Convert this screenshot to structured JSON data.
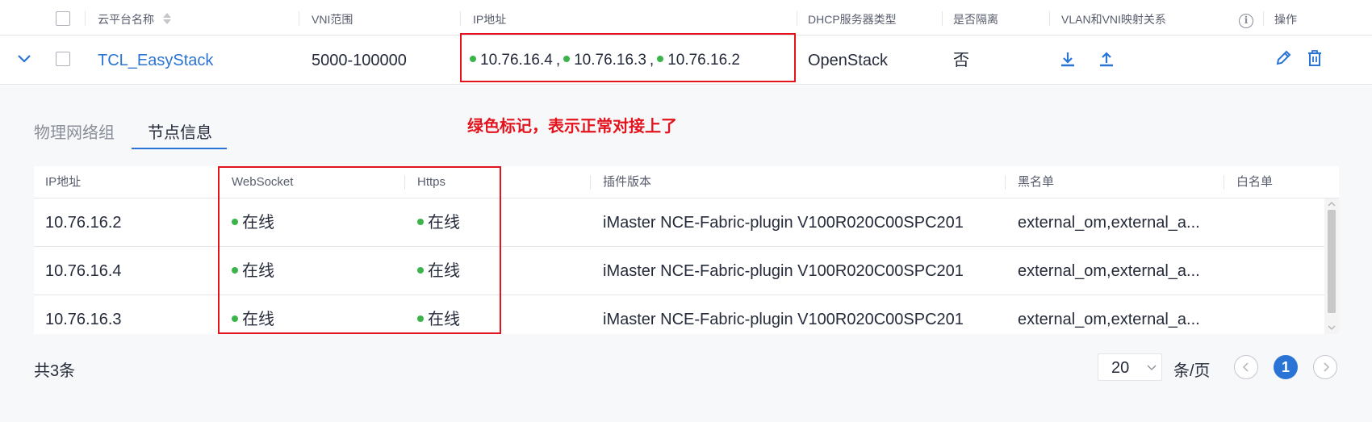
{
  "header": {
    "cloud_name": "云平台名称",
    "vni_range": "VNI范围",
    "ip_address": "IP地址",
    "dhcp_type": "DHCP服务器类型",
    "isolated": "是否隔离",
    "vlan_vni_map": "VLAN和VNI映射关系",
    "actions": "操作"
  },
  "row": {
    "cloud_name": "TCL_EasyStack",
    "vni_range": "5000-100000",
    "ips": [
      "10.76.16.4",
      "10.76.16.3",
      "10.76.16.2"
    ],
    "ip_separator": ",",
    "dhcp_type": "OpenStack",
    "isolated": "否"
  },
  "tabs": {
    "physical_group": "物理网络组",
    "node_info": "节点信息",
    "active": "node_info"
  },
  "annotation": "绿色标记，表示正常对接上了",
  "nodes_table": {
    "columns": {
      "ip": "IP地址",
      "websocket": "WebSocket",
      "https": "Https",
      "plugin_version": "插件版本",
      "blacklist": "黑名单",
      "whitelist": "白名单"
    },
    "rows": [
      {
        "ip": "10.76.16.2",
        "websocket": "在线",
        "https": "在线",
        "plugin_version": "iMaster NCE-Fabric-plugin V100R020C00SPC201",
        "blacklist": "external_om,external_a...",
        "whitelist": ""
      },
      {
        "ip": "10.76.16.4",
        "websocket": "在线",
        "https": "在线",
        "plugin_version": "iMaster NCE-Fabric-plugin V100R020C00SPC201",
        "blacklist": "external_om,external_a...",
        "whitelist": ""
      },
      {
        "ip": "10.76.16.3",
        "websocket": "在线",
        "https": "在线",
        "plugin_version": "iMaster NCE-Fabric-plugin V100R020C00SPC201",
        "blacklist": "external_om,external_a...",
        "whitelist": ""
      }
    ]
  },
  "pagination": {
    "total": "共3条",
    "page_size": "20",
    "per_page": "条/页",
    "current_page": "1"
  },
  "colors": {
    "online_dot": "#3bb54a",
    "accent": "#2a74d6",
    "highlight": "#e3141e"
  }
}
